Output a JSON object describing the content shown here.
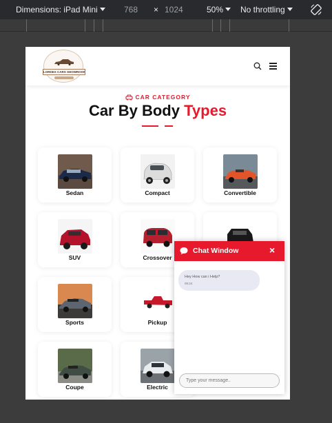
{
  "devtools": {
    "dimensions_label": "Dimensions: iPad Mini",
    "width": "768",
    "times": "×",
    "height": "1024",
    "zoom": "50%",
    "throttle": "No throttling"
  },
  "site": {
    "logo_text": "LORDEX CARS SHOWROOM",
    "category_label": "CAR CATEGORY",
    "title_part1": "Car By Body",
    "title_part2": "Types",
    "accent_color": "#e6192d"
  },
  "categories": [
    {
      "label": "Sedan"
    },
    {
      "label": "Compact"
    },
    {
      "label": "Convertible"
    },
    {
      "label": "SUV"
    },
    {
      "label": "Crossover"
    },
    {
      "label": ""
    },
    {
      "label": "Sports"
    },
    {
      "label": "Pickup"
    },
    {
      "label": ""
    },
    {
      "label": "Coupe"
    },
    {
      "label": "Electric"
    }
  ],
  "chat": {
    "title": "Chat Window",
    "close": "×",
    "message": "Hey How can i Help?",
    "time": "09:24",
    "input_placeholder": "Type your message.."
  }
}
